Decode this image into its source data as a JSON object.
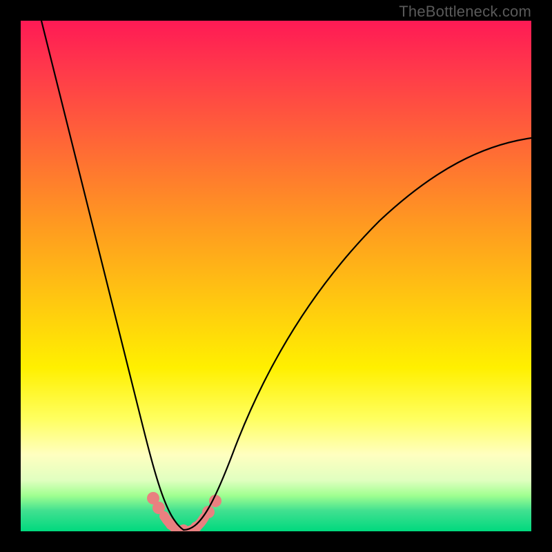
{
  "watermark": "TheBottleneck.com",
  "chart_data": {
    "type": "line",
    "title": "",
    "xlabel": "",
    "ylabel": "",
    "xlim": [
      0,
      100
    ],
    "ylim": [
      0,
      100
    ],
    "series": [
      {
        "name": "bottleneck-curve",
        "x": [
          0,
          5,
          10,
          15,
          20,
          24,
          27,
          30,
          32,
          34,
          36,
          40,
          45,
          50,
          55,
          60,
          70,
          80,
          90,
          100
        ],
        "y": [
          105,
          85,
          65,
          45,
          25,
          10,
          4,
          1,
          0,
          0,
          1,
          4,
          12,
          22,
          32,
          41,
          56,
          66,
          72,
          75
        ]
      }
    ],
    "highlight_points": {
      "name": "near-minimum-dots",
      "x": [
        26,
        27,
        30,
        32,
        34,
        37,
        38
      ],
      "y": [
        6,
        4,
        1,
        0,
        1,
        4,
        6
      ]
    },
    "color_gradient": {
      "top": "#ff1a55",
      "mid": "#fff000",
      "bottom": "#00d97e"
    }
  }
}
